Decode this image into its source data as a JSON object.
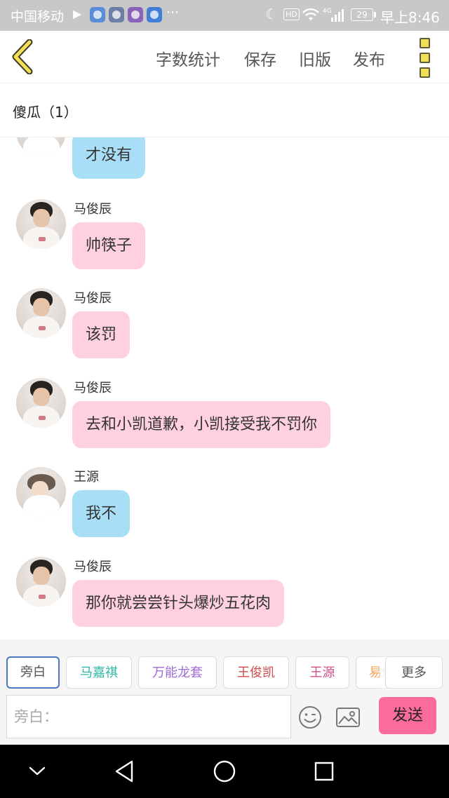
{
  "status_bar": {
    "carrier": "中国移动",
    "more_dots": "···",
    "hd_label": "HD",
    "network": "4G",
    "battery": "29",
    "time": "早上8:46"
  },
  "header": {
    "actions": {
      "word_count": "字数统计",
      "save": "保存",
      "old_version": "旧版",
      "publish": "发布"
    }
  },
  "title": "傻瓜（1）",
  "messages": [
    {
      "sender": "",
      "text": "才没有",
      "color": "blue",
      "avatar": "light"
    },
    {
      "sender": "马俊辰",
      "text": "帅筷子",
      "color": "pink",
      "avatar": "dark"
    },
    {
      "sender": "马俊辰",
      "text": "该罚",
      "color": "pink",
      "avatar": "dark"
    },
    {
      "sender": "马俊辰",
      "text": "去和小凯道歉，小凯接受我不罚你",
      "color": "pink",
      "avatar": "dark"
    },
    {
      "sender": "王源",
      "text": "我不",
      "color": "blue",
      "avatar": "light"
    },
    {
      "sender": "马俊辰",
      "text": "那你就尝尝针头爆炒五花肉",
      "color": "pink",
      "avatar": "dark"
    }
  ],
  "role_chips": [
    {
      "label": "旁白",
      "color": "#555555"
    },
    {
      "label": "马嘉祺",
      "color": "#2fb8a6"
    },
    {
      "label": "万能龙套",
      "color": "#a06bd6"
    },
    {
      "label": "王俊凯",
      "color": "#d24a4a"
    },
    {
      "label": "王源",
      "color": "#d3508c"
    },
    {
      "label": "易烊",
      "color": "#f0a050"
    }
  ],
  "more_button": "更多",
  "input": {
    "placeholder": "旁白：",
    "value": ""
  },
  "send_button": "发送",
  "colors": {
    "pink_bubble": "#ffd1de",
    "blue_bubble": "#a9dff6",
    "send_button": "#fb6c9b",
    "active_chip_border": "#4a78c2",
    "back_arrow": "#f2df56"
  },
  "icons": {
    "back": "chevron-left-icon",
    "menu": "more-vertical-icon",
    "emoji": "smiley-icon",
    "image": "image-icon"
  }
}
